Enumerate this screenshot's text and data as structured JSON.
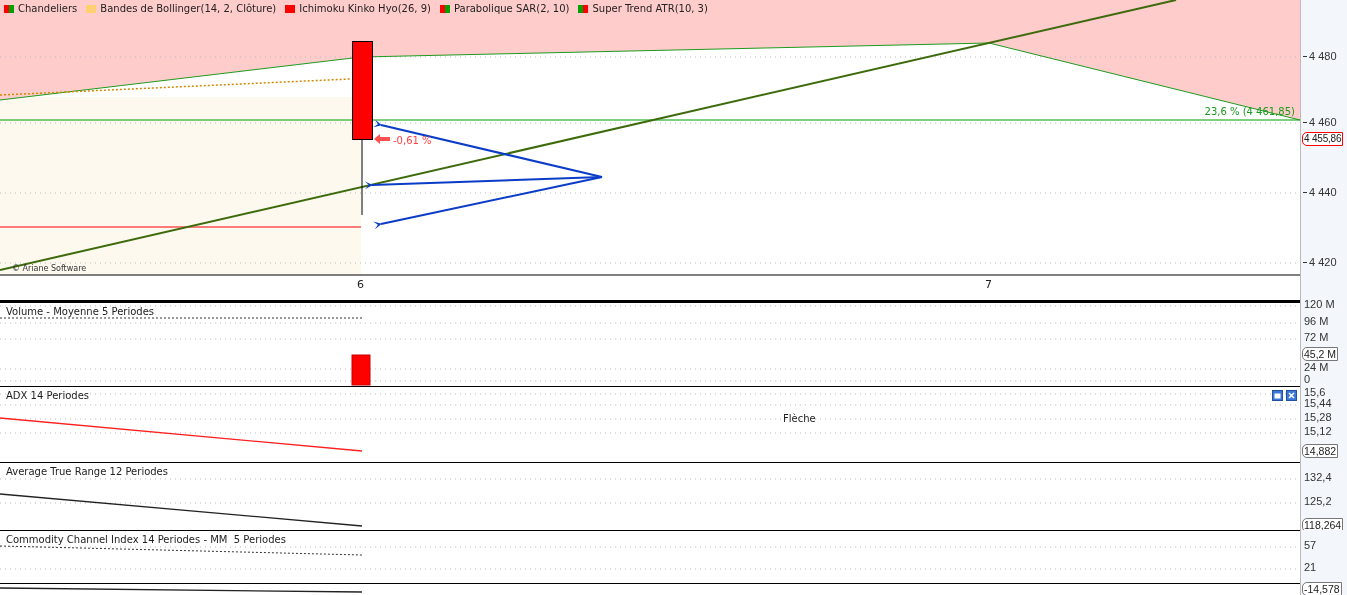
{
  "legend": [
    {
      "label": "Chandeliers",
      "swatches": [
        {
          "color": "#ff0000"
        },
        {
          "color": "#00a000"
        }
      ]
    },
    {
      "label": "Bandes de Bollinger(14, 2, Clôture)",
      "swatches": [
        {
          "color": "#ffd070"
        },
        {
          "color": "#ffd070"
        }
      ]
    },
    {
      "label": "Ichimoku Kinko Hyo(26, 9)",
      "swatches": [
        {
          "color": "#ff0000"
        },
        {
          "color": "#ff0000"
        }
      ]
    },
    {
      "label": "Parabolique SAR(2, 10)",
      "swatches": [
        {
          "color": "#ff0000"
        },
        {
          "color": "#00a000"
        }
      ]
    },
    {
      "label": "Super Trend ATR(10, 3)",
      "swatches": [
        {
          "color": "#00a000"
        },
        {
          "color": "#ff0000"
        }
      ]
    }
  ],
  "main": {
    "axis_labels": [
      "4 480",
      "4 460",
      "4 440",
      "4 420"
    ],
    "price_tag": "4 455,86",
    "fibonacci_label": "23,6 % (4 461,85)",
    "change_label": "-0,61 %",
    "copyright": "© Ariane Software"
  },
  "x_axis": {
    "labels": [
      "6",
      "7"
    ]
  },
  "panes": [
    {
      "kind": "volume",
      "title": "Volume - Moyenne 5 Periodes",
      "axis_labels": [
        "120 M",
        "96 M",
        "72 M",
        "24 M",
        "0"
      ],
      "price_tag": "45,2 M"
    },
    {
      "kind": "adx",
      "title": "ADX 14 Periodes",
      "axis_labels": [
        "15,6",
        "15,44",
        "15,28",
        "15,12"
      ],
      "price_tag": "14,882",
      "tooltip": "Flèche"
    },
    {
      "kind": "atr",
      "title": "Average True Range 12 Periodes",
      "axis_labels": [
        "132,4",
        "125,2"
      ],
      "price_tag": "118,264"
    },
    {
      "kind": "cci",
      "title": "Commodity Channel Index 14 Periodes - MM  5 Periodes",
      "axis_labels": [
        "57",
        "21"
      ]
    },
    {
      "kind": "tail",
      "price_tag": "-14,578"
    }
  ]
}
